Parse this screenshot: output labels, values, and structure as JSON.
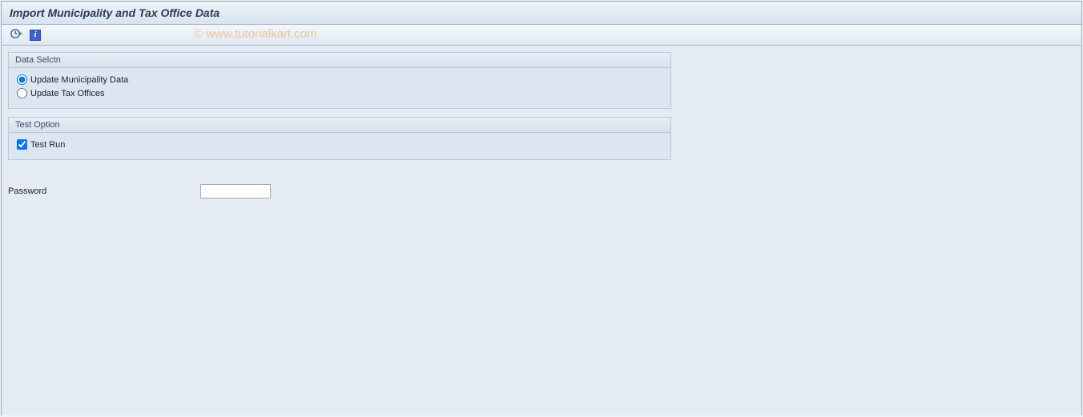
{
  "header": {
    "title": "Import Municipality and Tax Office Data"
  },
  "toolbar": {
    "execute_tooltip": "Execute",
    "info_tooltip": "Information"
  },
  "watermark": "© www.tutorialkart.com",
  "groups": {
    "data_select": {
      "title": "Data Selctn",
      "opt_municipality": "Update Municipality Data",
      "opt_tax_offices": "Update Tax Offices"
    },
    "test_option": {
      "title": "Test Option",
      "test_run": "Test Run"
    }
  },
  "fields": {
    "password_label": "Password",
    "password_value": ""
  },
  "state": {
    "selected_radio": "municipality",
    "test_run_checked": true
  }
}
